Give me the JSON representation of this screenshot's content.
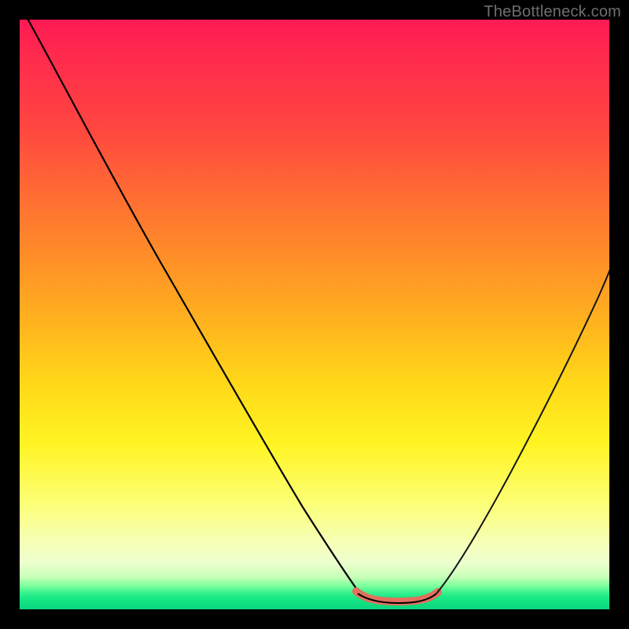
{
  "watermark": {
    "text": "TheBottleneck.com"
  },
  "colors": {
    "curve_left": "#000000",
    "curve_right": "#141414",
    "valley_highlight": "#e2705d"
  },
  "chart_data": {
    "type": "line",
    "title": "",
    "xlabel": "",
    "ylabel": "",
    "xlim": [
      0,
      100
    ],
    "ylim": [
      0,
      100
    ],
    "grid": false,
    "legend": false,
    "note": "Values estimated from pixel positions; axes have no tick labels in the original image. y is the visible vertical position of the curve (0 = bottom/green, 100 = top/red).",
    "series": [
      {
        "name": "left-branch",
        "x": [
          1,
          5,
          10,
          15,
          20,
          25,
          30,
          35,
          40,
          45,
          50,
          53,
          56,
          58
        ],
        "y": [
          100,
          92,
          83,
          74,
          64,
          54,
          45,
          36,
          27,
          18,
          10,
          6,
          3,
          2
        ]
      },
      {
        "name": "valley-floor",
        "x": [
          58,
          60,
          63,
          66,
          69,
          71
        ],
        "y": [
          2,
          1.5,
          1.3,
          1.3,
          1.6,
          2
        ]
      },
      {
        "name": "right-branch",
        "x": [
          71,
          74,
          78,
          82,
          86,
          90,
          94,
          98,
          100
        ],
        "y": [
          3,
          7,
          14,
          22,
          31,
          40,
          50,
          59,
          64
        ]
      }
    ],
    "highlight": {
      "name": "valley-overlay",
      "color_ref": "valley_highlight",
      "x_range": [
        57,
        72
      ],
      "y_approx": 2
    }
  }
}
